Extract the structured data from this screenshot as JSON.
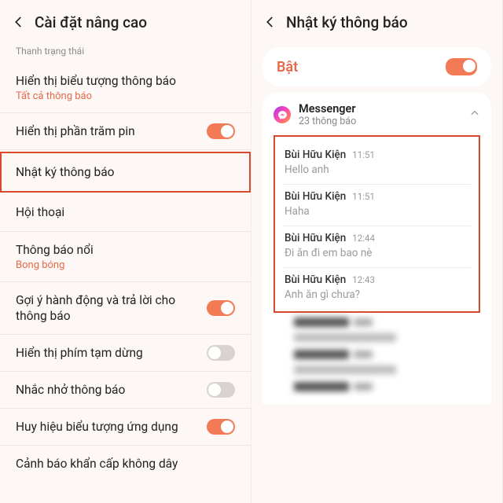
{
  "left": {
    "title": "Cài đặt nâng cao",
    "section": "Thanh trạng thái",
    "rows": {
      "notif_icon": {
        "title": "Hiển thị biểu tượng thông báo",
        "sub": "Tất cả thông báo"
      },
      "battery": {
        "title": "Hiển thị phần trăm pin"
      },
      "log": {
        "title": "Nhật ký thông báo"
      },
      "convo": {
        "title": "Hội thoại"
      },
      "floating": {
        "title": "Thông báo nổi",
        "sub": "Bong bóng"
      },
      "suggest": {
        "title": "Gợi ý hành động và trả lời cho thông báo"
      },
      "snooze": {
        "title": "Hiển thị phím tạm dừng"
      },
      "remind": {
        "title": "Nhắc nhở thông báo"
      },
      "badge": {
        "title": "Huy hiệu biểu tượng ứng dụng"
      },
      "emergency": {
        "title": "Cảnh báo khẩn cấp không dây"
      }
    }
  },
  "right": {
    "title": "Nhật ký thông báo",
    "enable": "Bật",
    "app": {
      "name": "Messenger",
      "count": "23 thông báo"
    },
    "messages": [
      {
        "sender": "Bùi Hữu Kiện",
        "time": "11:51",
        "body": "Hello anh"
      },
      {
        "sender": "Bùi Hữu Kiện",
        "time": "11:51",
        "body": "Haha"
      },
      {
        "sender": "Bùi Hữu Kiện",
        "time": "12:44",
        "body": "Đi ăn đi em bao nè"
      },
      {
        "sender": "Bùi Hữu Kiện",
        "time": "12:43",
        "body": "Anh ăn gì chưa?"
      }
    ]
  }
}
